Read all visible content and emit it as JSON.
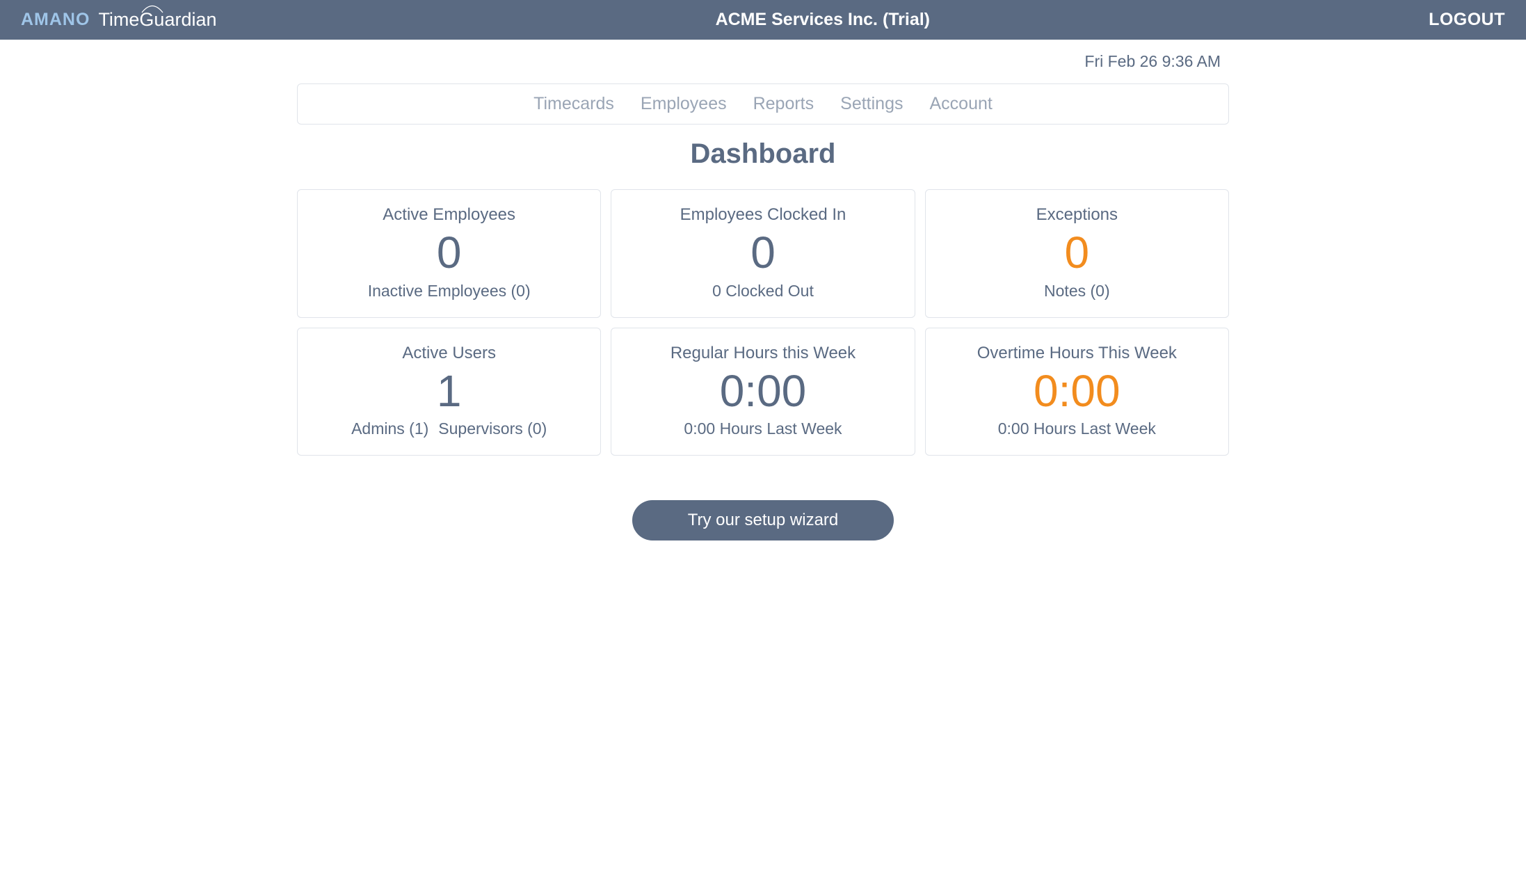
{
  "header": {
    "logo_brand": "AMANO",
    "logo_product": "TimeGuardian",
    "company_title": "ACME Services Inc. (Trial)",
    "logout_label": "LOGOUT"
  },
  "datetime": "Fri Feb 26 9:36 AM",
  "nav": {
    "items": [
      {
        "label": "Timecards"
      },
      {
        "label": "Employees"
      },
      {
        "label": "Reports"
      },
      {
        "label": "Settings"
      },
      {
        "label": "Account"
      }
    ]
  },
  "page_title": "Dashboard",
  "cards": [
    {
      "title": "Active Employees",
      "value": "0",
      "value_orange": false,
      "subs": [
        "Inactive Employees (0)"
      ]
    },
    {
      "title": "Employees Clocked In",
      "value": "0",
      "value_orange": false,
      "subs": [
        "0 Clocked Out"
      ]
    },
    {
      "title": "Exceptions",
      "value": "0",
      "value_orange": true,
      "subs": [
        "Notes (0)"
      ]
    },
    {
      "title": "Active Users",
      "value": "1",
      "value_orange": false,
      "subs": [
        "Admins (1)",
        "Supervisors (0)"
      ]
    },
    {
      "title": "Regular Hours this Week",
      "value": "0:00",
      "value_orange": false,
      "subs": [
        "0:00 Hours Last Week"
      ]
    },
    {
      "title": "Overtime Hours This Week",
      "value": "0:00",
      "value_orange": true,
      "subs": [
        "0:00 Hours Last Week"
      ]
    }
  ],
  "wizard_button_label": "Try our setup wizard"
}
